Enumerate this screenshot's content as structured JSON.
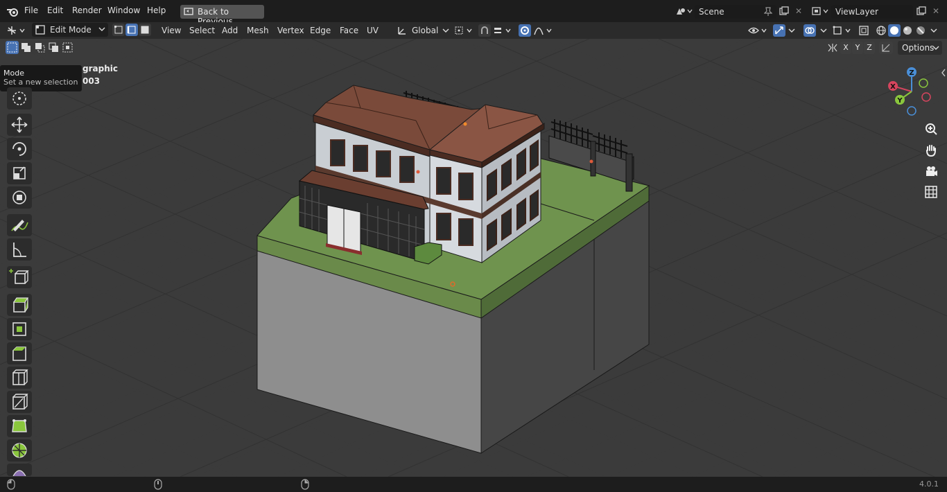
{
  "menu": {
    "items": [
      "File",
      "Edit",
      "Render",
      "Window",
      "Help"
    ],
    "back_button": "Back to Previous"
  },
  "scene": {
    "label": "Scene"
  },
  "view_layer": {
    "label": "ViewLayer"
  },
  "header": {
    "mode": "Edit Mode",
    "menus": [
      "View",
      "Select",
      "Add",
      "Mesh",
      "Vertex",
      "Edge",
      "Face",
      "UV"
    ],
    "orientation": "Global"
  },
  "axes_buttons": [
    "X",
    "Y",
    "Z"
  ],
  "options_label": "Options",
  "viewport_overlay": {
    "line1": "graphic",
    "line2": "003"
  },
  "tooltip": {
    "title": "Mode",
    "body": "Set a new selection"
  },
  "gizmo": {
    "x": "X",
    "y": "Y",
    "z": "Z"
  },
  "version": "4.0.1",
  "colors": {
    "accent": "#4772b3",
    "x_axis": "#d6455e",
    "y_axis": "#8ac63d",
    "z_axis": "#4a8fd8",
    "grass": "#6f934e"
  }
}
